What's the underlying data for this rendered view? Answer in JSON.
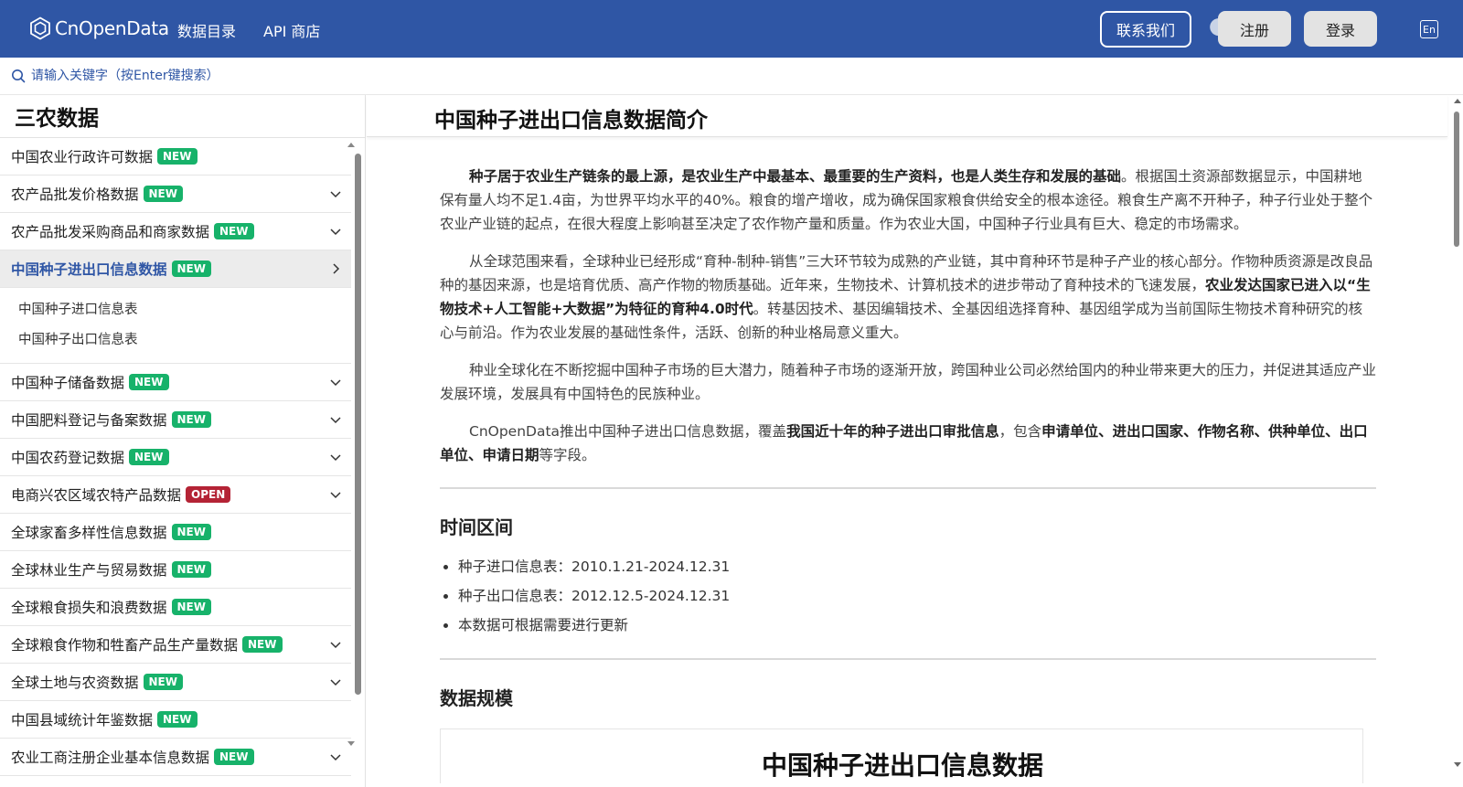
{
  "header": {
    "logo_text": "CnOpenData",
    "nav": [
      "数据目录",
      "API 商店"
    ],
    "contact_label": "联系我们",
    "register_label": "注册",
    "login_label": "登录",
    "lang_label": "En",
    "brand_color": "#2f56a5"
  },
  "search": {
    "placeholder": "请输入关键字（按Enter键搜索）"
  },
  "sidebar": {
    "title": "三农数据",
    "items": [
      {
        "label": "中国农业行政许可数据",
        "badge": "NEW",
        "chevron": false
      },
      {
        "label": "农产品批发价格数据",
        "badge": "NEW",
        "chevron": true
      },
      {
        "label": "农产品批发采购商品和商家数据",
        "badge": "NEW",
        "chevron": true
      },
      {
        "label": "中国种子进出口信息数据",
        "badge": "NEW",
        "chevron": true,
        "active": true,
        "children": [
          "中国种子进口信息表",
          "中国种子出口信息表"
        ]
      },
      {
        "label": "中国种子储备数据",
        "badge": "NEW",
        "chevron": true
      },
      {
        "label": "中国肥料登记与备案数据",
        "badge": "NEW",
        "chevron": true
      },
      {
        "label": "中国农药登记数据",
        "badge": "NEW",
        "chevron": true
      },
      {
        "label": "电商兴农区域农特产品数据",
        "badge": "OPEN",
        "chevron": true
      },
      {
        "label": "全球家畜多样性信息数据",
        "badge": "NEW",
        "chevron": false
      },
      {
        "label": "全球林业生产与贸易数据",
        "badge": "NEW",
        "chevron": false
      },
      {
        "label": "全球粮食损失和浪费数据",
        "badge": "NEW",
        "chevron": false
      },
      {
        "label": "全球粮食作物和牲畜产品生产量数据",
        "badge": "NEW",
        "chevron": true
      },
      {
        "label": "全球土地与农资数据",
        "badge": "NEW",
        "chevron": true
      },
      {
        "label": "中国县域统计年鉴数据",
        "badge": "NEW",
        "chevron": false
      },
      {
        "label": "农业工商注册企业基本信息数据",
        "badge": "NEW",
        "chevron": true
      }
    ]
  },
  "main": {
    "title": "中国种子进出口信息数据简介",
    "paragraphs": [
      [
        {
          "b": true,
          "t": "种子居于农业生产链条的最上源，是农业生产中最基本、最重要的生产资料，也是人类生存和发展的基础"
        },
        {
          "b": false,
          "t": "。根据国土资源部数据显示，中国耕地保有量人均不足1.4亩，为世界平均水平的40%。粮食的增产增收，成为确保国家粮食供给安全的根本途径。粮食生产离不开种子，种子行业处于整个农业产业链的起点，在很大程度上影响甚至决定了农作物产量和质量。作为农业大国，中国种子行业具有巨大、稳定的市场需求。"
        }
      ],
      [
        {
          "b": false,
          "t": "从全球范围来看，全球种业已经形成“育种-制种-销售”三大环节较为成熟的产业链，其中育种环节是种子产业的核心部分。作物种质资源是改良品种的基因来源，也是培育优质、高产作物的物质基础。近年来，生物技术、计算机技术的进步带动了育种技术的飞速发展，"
        },
        {
          "b": true,
          "t": "农业发达国家已进入以“生物技术+人工智能+大数据”为特征的育种4.0时代"
        },
        {
          "b": false,
          "t": "。转基因技术、基因编辑技术、全基因组选择育种、基因组学成为当前国际生物技术育种研究的核心与前沿。作为农业发展的基础性条件，活跃、创新的种业格局意义重大。"
        }
      ],
      [
        {
          "b": false,
          "t": "种业全球化在不断挖掘中国种子市场的巨大潜力，随着种子市场的逐渐开放，跨国种业公司必然给国内的种业带来更大的压力，并促进其适应产业发展环境，发展具有中国特色的民族种业。"
        }
      ],
      [
        {
          "b": false,
          "t": "CnOpenData推出中国种子进出口信息数据，覆盖"
        },
        {
          "b": true,
          "t": "我国近十年的种子进出口审批信息"
        },
        {
          "b": false,
          "t": "，包含"
        },
        {
          "b": true,
          "t": "申请单位、进出口国家、作物名称、供种单位、出口单位、申请日期"
        },
        {
          "b": false,
          "t": "等字段。"
        }
      ]
    ],
    "time_heading": "时间区间",
    "time_items": [
      "种子进口信息表：2010.1.21-2024.12.31",
      "种子出口信息表：2012.12.5-2024.12.31",
      "本数据可根据需要进行更新"
    ],
    "scale_heading": "数据规模",
    "preview_title": "中国种子进出口信息数据"
  }
}
